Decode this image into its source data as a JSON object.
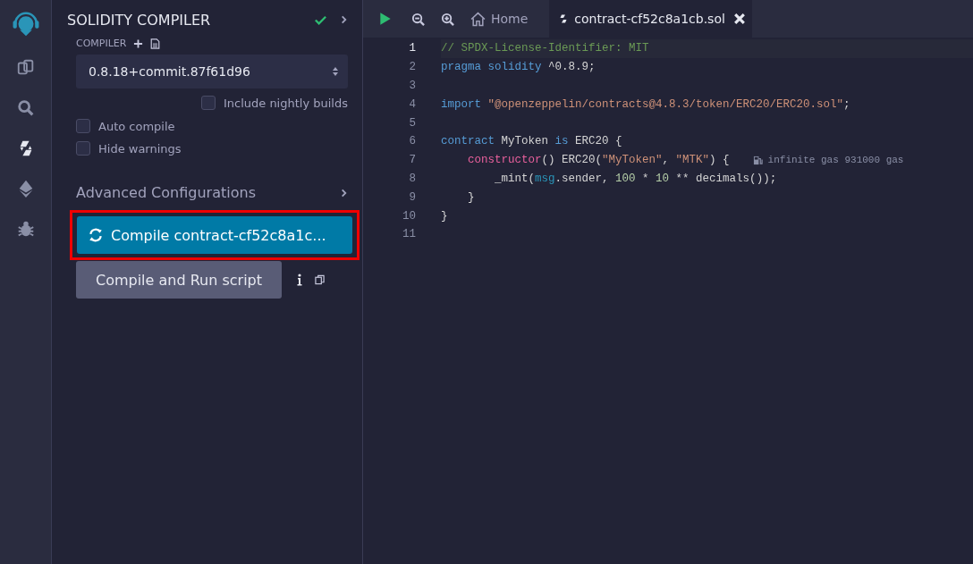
{
  "panel": {
    "title": "SOLIDITY COMPILER",
    "compiled": true,
    "compiler_label": "COMPILER",
    "compiler_version": "0.8.18+commit.87f61d96",
    "options": [
      {
        "label": "Include nightly builds",
        "checked": false,
        "kind": "right"
      },
      {
        "label": "Auto compile",
        "checked": false,
        "kind": "left"
      },
      {
        "label": "Hide warnings",
        "checked": false,
        "kind": "left"
      }
    ],
    "advanced": {
      "label": "Advanced Configurations",
      "expanded": false
    },
    "compile_button": {
      "label": "Compile contract-cf52c8a1c...",
      "highlighted": true
    },
    "run_button": {
      "label": "Compile and Run script"
    }
  },
  "tabs": [
    {
      "label": "Home",
      "kind": "home",
      "selected": false
    },
    {
      "label": "contract-cf52c8a1cb.sol",
      "kind": "file",
      "selected": true
    }
  ],
  "editor": {
    "lines": [
      {
        "number": "1",
        "active": true,
        "tokens": [
          {
            "text": "// SPDX-License-Identifier: MIT",
            "kind": "comment"
          }
        ]
      },
      {
        "number": "2",
        "active": false,
        "tokens": [
          {
            "text": "pragma solidity",
            "kind": "keyword"
          },
          {
            "text": " ^0.8.9;",
            "kind": "plain"
          }
        ]
      },
      {
        "number": "3",
        "active": false
      },
      {
        "number": "4",
        "active": false,
        "tokens": [
          {
            "text": "import",
            "kind": "keyword"
          },
          {
            "text": " \"@openzeppelin/contracts@4.8.3/token/ERC20/ERC20.sol\"",
            "kind": "string"
          },
          {
            "text": ";",
            "kind": "plain"
          }
        ]
      },
      {
        "number": "5",
        "active": false
      },
      {
        "number": "6",
        "active": false,
        "tokens": [
          {
            "text": "contract",
            "kind": "keyword"
          },
          {
            "text": " MyToken ",
            "kind": "plain"
          },
          {
            "text": "is",
            "kind": "keyword"
          },
          {
            "text": " ERC20 {",
            "kind": "plain"
          }
        ]
      },
      {
        "number": "7",
        "active": false,
        "tokens": [
          {
            "text": "    constructor",
            "kind": "func"
          },
          {
            "text": "() ERC20(",
            "kind": "plain"
          },
          {
            "text": "\"MyToken\"",
            "kind": "string"
          },
          {
            "text": ", ",
            "kind": "plain"
          },
          {
            "text": "\"MTK\"",
            "kind": "string"
          },
          {
            "text": ") {",
            "kind": "plain"
          }
        ],
        "gas": "infinite gas 931000 gas"
      },
      {
        "number": "8",
        "active": false,
        "tokens": [
          {
            "text": "        _mint(",
            "kind": "plain"
          },
          {
            "text": "msg",
            "kind": "builtin"
          },
          {
            "text": ".sender, ",
            "kind": "plain"
          },
          {
            "text": "100",
            "kind": "number"
          },
          {
            "text": " * ",
            "kind": "plain"
          },
          {
            "text": "10",
            "kind": "number"
          },
          {
            "text": " ** decimals());",
            "kind": "plain"
          }
        ]
      },
      {
        "number": "9",
        "active": false,
        "tokens": [
          {
            "text": "    }",
            "kind": "plain"
          }
        ]
      },
      {
        "number": "10",
        "active": false,
        "tokens": [
          {
            "text": "}",
            "kind": "plain"
          }
        ]
      },
      {
        "number": "11",
        "active": false
      }
    ]
  }
}
